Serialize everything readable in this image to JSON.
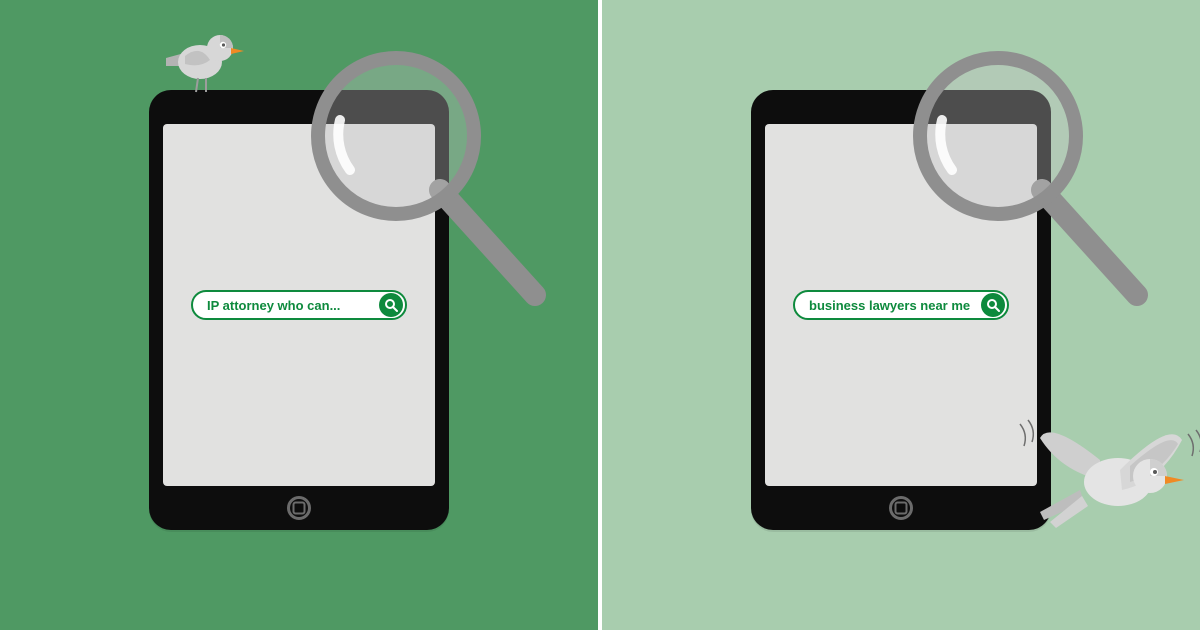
{
  "panels": {
    "left": {
      "bg": "#4f9963",
      "search_query": "IP attorney who can..."
    },
    "right": {
      "bg": "#a8cdae",
      "search_query": "business lawyers near me"
    }
  },
  "colors": {
    "accent": "#0e8a3d",
    "tablet": "#0d0d0d",
    "screen": "#e1e1e0",
    "magnifier_handle": "#8f8f8f",
    "magnifier_ring": "#a5a5a5"
  }
}
